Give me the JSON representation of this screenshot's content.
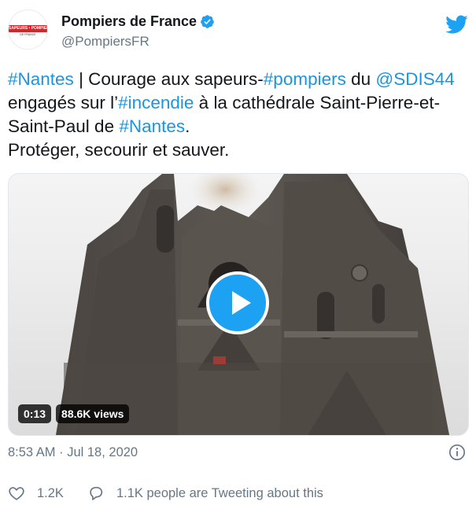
{
  "account": {
    "display_name": "Pompiers de France",
    "handle": "@PompiersFR",
    "avatar_ribbon": "SAPEURS • POMPIERS",
    "avatar_sub": "DE FRANCE",
    "verified_icon": "verified-badge-icon",
    "brand_icon": "twitter-bird-icon"
  },
  "tweet": {
    "line1": {
      "t0": "#Nantes",
      "t1": " | Courage aux sapeurs-",
      "t2": "#pompiers",
      "t3": " du ",
      "t4": "@SDIS44"
    },
    "line2": {
      "t0": "engagés sur l’",
      "t1": "#incendie",
      "t2": " à la cathédrale Saint-Pierre-et-"
    },
    "line3": {
      "t0": "Saint-Paul de ",
      "t1": "#Nantes",
      "t2": "."
    },
    "line4": "Protéger, secourir et sauver."
  },
  "media": {
    "duration": "0:13",
    "views": "88.6K views",
    "play_icon": "play-icon"
  },
  "meta": {
    "timestamp": "8:53 AM · Jul 18, 2020",
    "info_icon": "info-icon"
  },
  "actions": {
    "likes": "1.2K",
    "conversation": "1.1K people are Tweeting about this",
    "like_icon": "heart-icon",
    "reply_icon": "speech-bubble-icon"
  },
  "colors": {
    "link": "#1b95e0",
    "brand": "#1da1f2",
    "secondary_text": "#657786",
    "primary_text": "#14171a"
  }
}
